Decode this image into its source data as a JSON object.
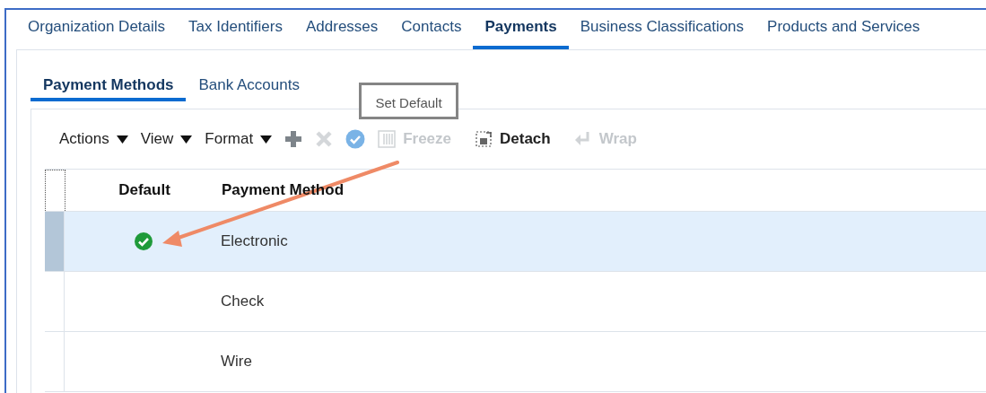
{
  "tabs": [
    {
      "label": "Organization Details",
      "selected": false
    },
    {
      "label": "Tax Identifiers",
      "selected": false
    },
    {
      "label": "Addresses",
      "selected": false
    },
    {
      "label": "Contacts",
      "selected": false
    },
    {
      "label": "Payments",
      "selected": true
    },
    {
      "label": "Business Classifications",
      "selected": false
    },
    {
      "label": "Products and Services",
      "selected": false
    }
  ],
  "sub_tabs": [
    {
      "label": "Payment Methods",
      "selected": true
    },
    {
      "label": "Bank Accounts",
      "selected": false
    }
  ],
  "tooltip": {
    "text": "Set Default"
  },
  "toolbar": [
    {
      "kind": "menu",
      "label": "Actions",
      "disabled": false
    },
    {
      "kind": "menu",
      "label": "View",
      "disabled": false
    },
    {
      "kind": "menu",
      "label": "Format",
      "disabled": false
    },
    {
      "kind": "add",
      "disabled": false
    },
    {
      "kind": "delete",
      "disabled": true
    },
    {
      "kind": "set-default",
      "disabled": false
    },
    {
      "kind": "freeze",
      "label": "Freeze",
      "disabled": true
    },
    {
      "kind": "detach",
      "label": "Detach",
      "disabled": false
    },
    {
      "kind": "wrap",
      "label": "Wrap",
      "disabled": true
    }
  ],
  "table": {
    "columns": [
      "Default",
      "Payment Method"
    ],
    "rows": [
      {
        "default": true,
        "method": "Electronic",
        "selected": true
      },
      {
        "default": false,
        "method": "Check",
        "selected": false
      },
      {
        "default": false,
        "method": "Wire",
        "selected": false
      }
    ]
  }
}
